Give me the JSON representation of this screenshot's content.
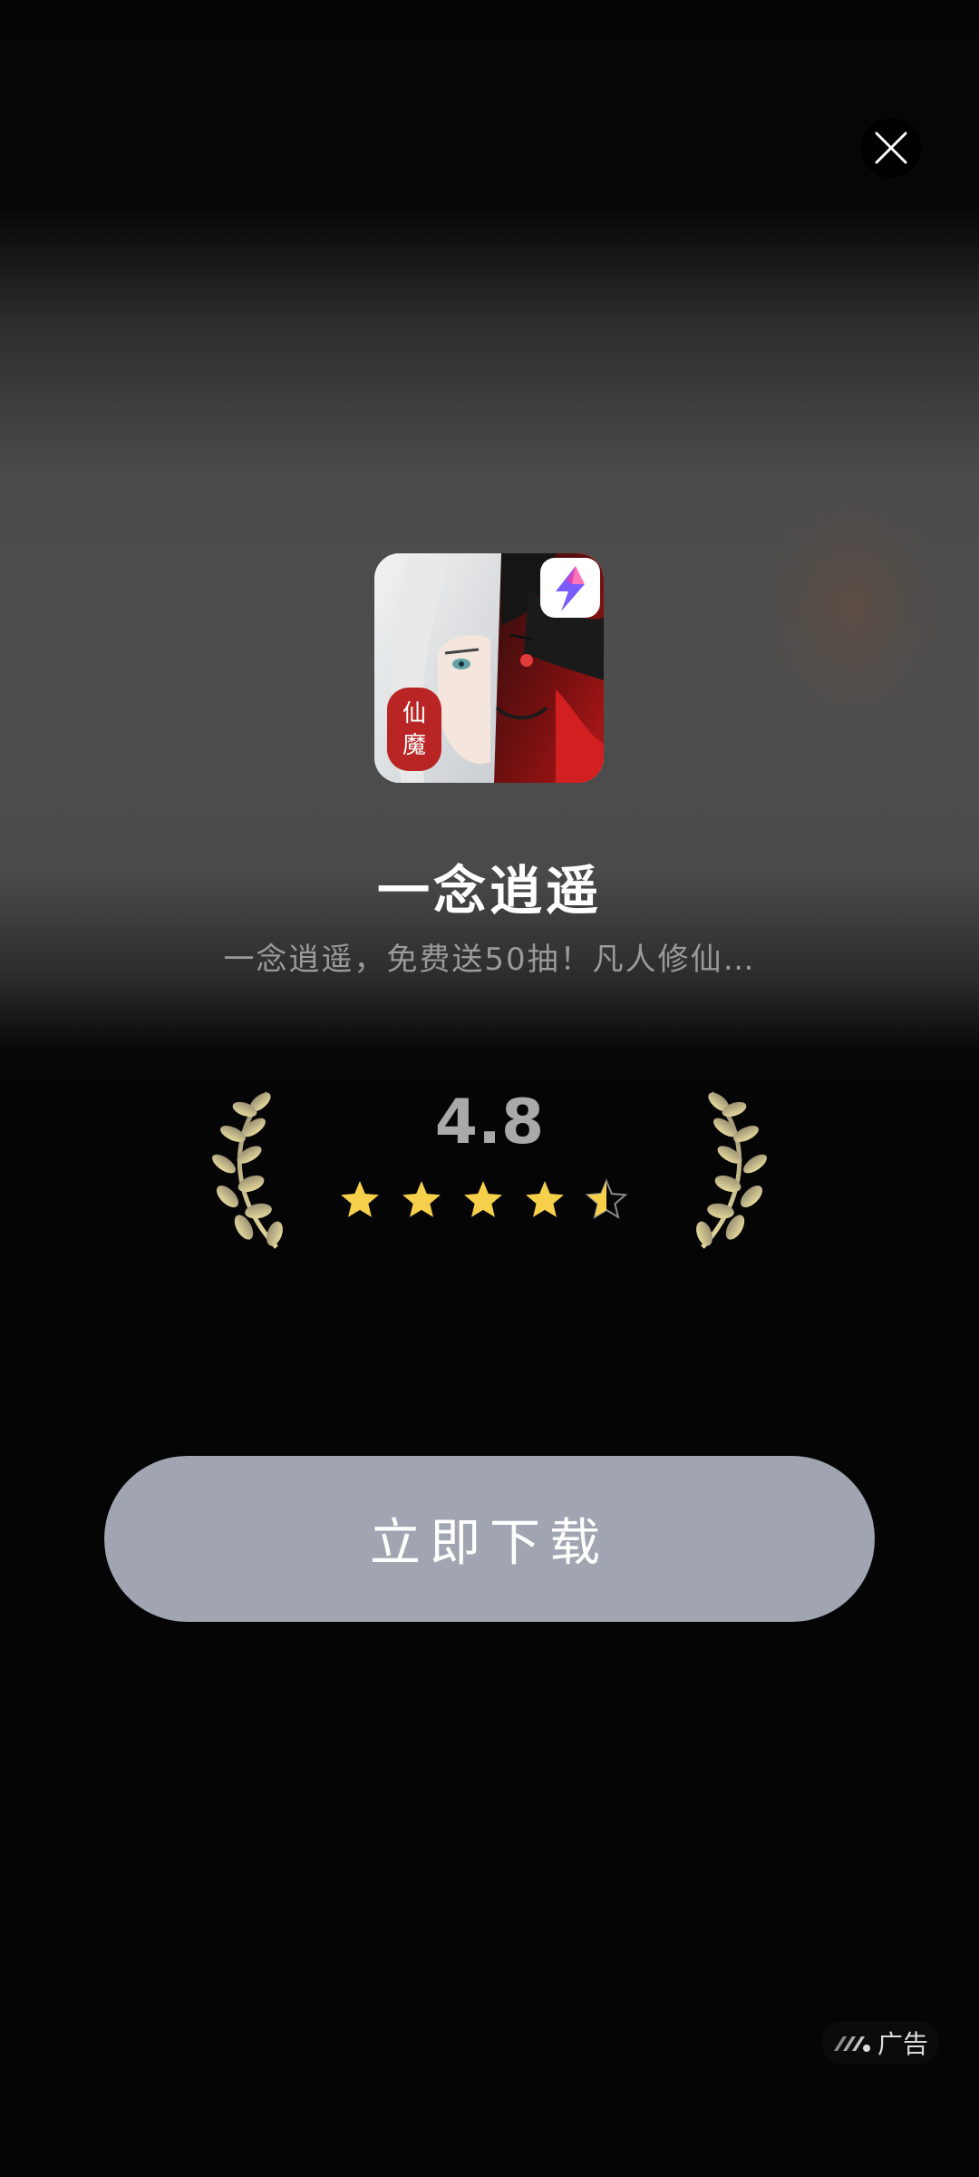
{
  "app": {
    "name": "一念逍遥",
    "description": "一念逍遥，免费送50抽！凡人修仙…",
    "icon_text": "仙魔",
    "icon_name": "app-icon-xianmo"
  },
  "rating": {
    "value": "4.8",
    "stars_value": 4.5,
    "stars_max": 5,
    "star_color": "#f7d04b"
  },
  "actions": {
    "download_label": "立即下载",
    "close_icon": "close-icon"
  },
  "ad_badge": {
    "label": "广告",
    "icon": "ad-logo-icon"
  },
  "colors": {
    "button_bg": "#a0a5b1",
    "background": "#050505",
    "laurel_gold": "#cfc18a"
  }
}
